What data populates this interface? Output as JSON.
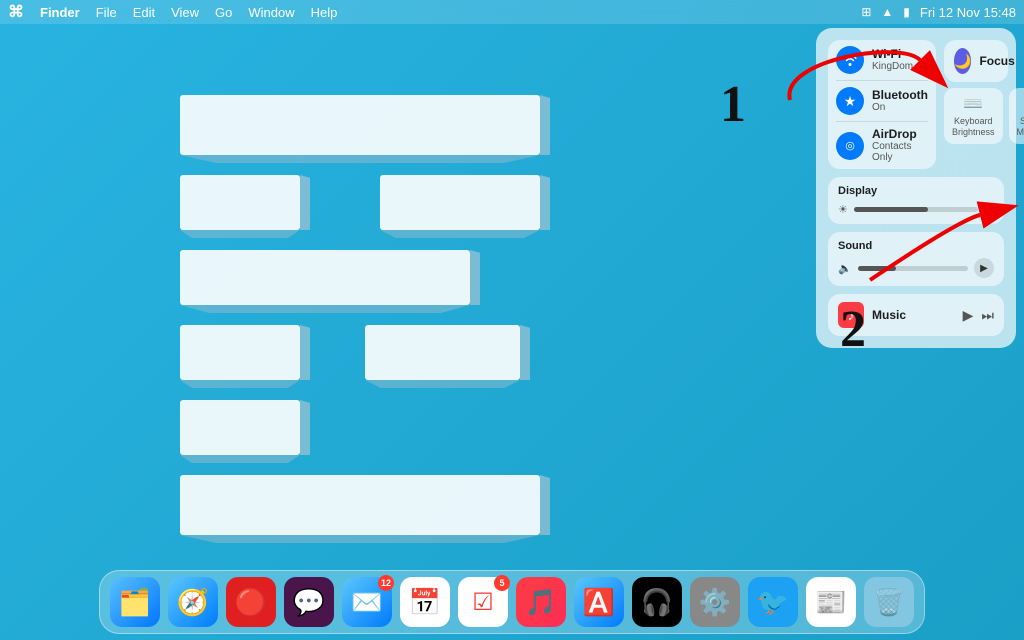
{
  "menubar": {
    "apple": "⌘",
    "app": "Finder",
    "menus": [
      "File",
      "Edit",
      "View",
      "Go",
      "Window",
      "Help"
    ],
    "time": "Fri 12 Nov  15:48",
    "icons": [
      "control-center-icon",
      "wifi-icon",
      "battery-icon"
    ]
  },
  "control_center": {
    "wifi": {
      "label": "Wi-Fi",
      "sublabel": "KingDom",
      "icon": "wifi"
    },
    "bluetooth": {
      "label": "Bluetooth",
      "sublabel": "On",
      "icon": "bluetooth"
    },
    "airdrop": {
      "label": "AirDrop",
      "sublabel": "Contacts Only",
      "icon": "airdrop"
    },
    "keyboard_brightness": {
      "label": "Keyboard Brightness",
      "icon": "keyboard"
    },
    "screen_mirroring": {
      "label": "Screen Mirroring",
      "icon": "mirror"
    },
    "focus": {
      "label": "Focus",
      "icon": "moon"
    },
    "display": {
      "label": "Display",
      "slider_value": 60
    },
    "sound": {
      "label": "Sound",
      "slider_value": 35
    },
    "music": {
      "label": "Music",
      "icon": "music-note"
    }
  },
  "annotations": {
    "num1": "1",
    "num2": "2"
  },
  "dock": {
    "items": [
      {
        "name": "Finder",
        "emoji": "🗂️",
        "color": "#0076ff"
      },
      {
        "name": "Safari",
        "emoji": "🧭",
        "color": "#0076ff"
      },
      {
        "name": "Vivaldi",
        "emoji": "🔴",
        "color": "#e02020"
      },
      {
        "name": "Slack",
        "emoji": "💬",
        "color": "#4a154b"
      },
      {
        "name": "Mail",
        "emoji": "✉️",
        "color": "#0076ff",
        "badge": "12"
      },
      {
        "name": "Calendar",
        "emoji": "📅",
        "color": "#fff"
      },
      {
        "name": "Reminders",
        "emoji": "📋",
        "color": "#fff"
      },
      {
        "name": "Music",
        "emoji": "🎵",
        "color": "#fc3c44"
      },
      {
        "name": "App Store",
        "emoji": "🅰️",
        "color": "#0076ff"
      },
      {
        "name": "Spotify",
        "emoji": "🎧",
        "color": "#1db954"
      },
      {
        "name": "System Preferences",
        "emoji": "⚙️",
        "color": "#888"
      },
      {
        "name": "Twitter",
        "emoji": "🐦",
        "color": "#1da1f2"
      },
      {
        "name": "News",
        "emoji": "📰",
        "color": "#f00"
      },
      {
        "name": "Trash",
        "emoji": "🗑️",
        "color": "#888"
      }
    ]
  }
}
